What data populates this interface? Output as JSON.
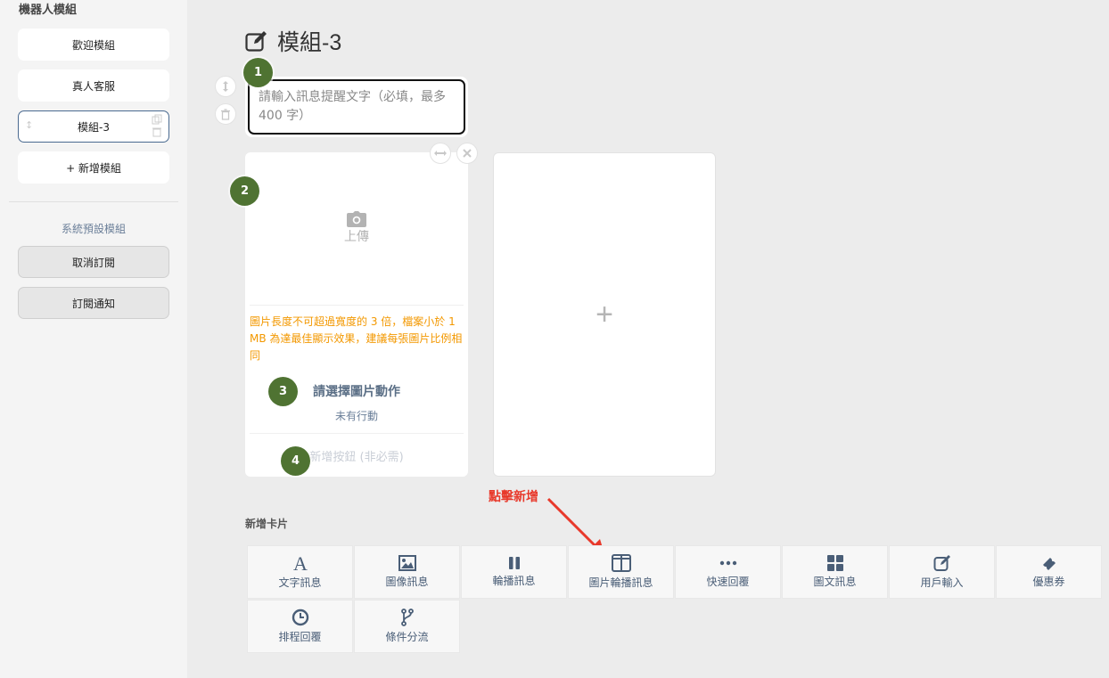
{
  "sidebar": {
    "title": "機器人模組",
    "modules": [
      {
        "label": "歡迎模組"
      },
      {
        "label": "真人客服"
      },
      {
        "label": "模組-3"
      },
      {
        "label": "+ 新增模組"
      }
    ],
    "system_title": "系統預設模組",
    "system_modules": [
      {
        "label": "取消訂閱"
      },
      {
        "label": "訂閱通知"
      }
    ]
  },
  "main": {
    "title": "模組-3",
    "text_input": {
      "value": "",
      "placeholder": "請輸入訊息提醒文字（必填，最多 400 字）"
    },
    "badges": [
      "1",
      "2",
      "3",
      "4"
    ],
    "card": {
      "upload_label": "上傳",
      "note": "圖片長度不可超過寬度的 3 倍，檔案小於 1 MB 為達最佳顯示效果，建議每張圖片比例相同",
      "action_title": "請選擇圖片動作",
      "action_sub": "未有行動",
      "add_button": "新增按鈕 (非必需)"
    },
    "add_card_symbol": "+",
    "hint": "點擊新增",
    "section_label": "新增卡片",
    "tools": [
      {
        "label": "文字訊息",
        "icon": "text-icon"
      },
      {
        "label": "圖像訊息",
        "icon": "image-icon"
      },
      {
        "label": "輪播訊息",
        "icon": "carousel-icon"
      },
      {
        "label": "圖片輪播訊息",
        "icon": "image-carousel-icon"
      },
      {
        "label": "快速回覆",
        "icon": "dots-icon"
      },
      {
        "label": "圖文訊息",
        "icon": "grid-icon"
      },
      {
        "label": "用戶輸入",
        "icon": "edit-icon"
      },
      {
        "label": "優惠券",
        "icon": "ticket-icon"
      },
      {
        "label": "排程回覆",
        "icon": "clock-icon"
      },
      {
        "label": "條件分流",
        "icon": "branch-icon"
      }
    ]
  },
  "colors": {
    "accent": "#4f7332",
    "warning": "#f39800",
    "hint": "#e8392b"
  }
}
